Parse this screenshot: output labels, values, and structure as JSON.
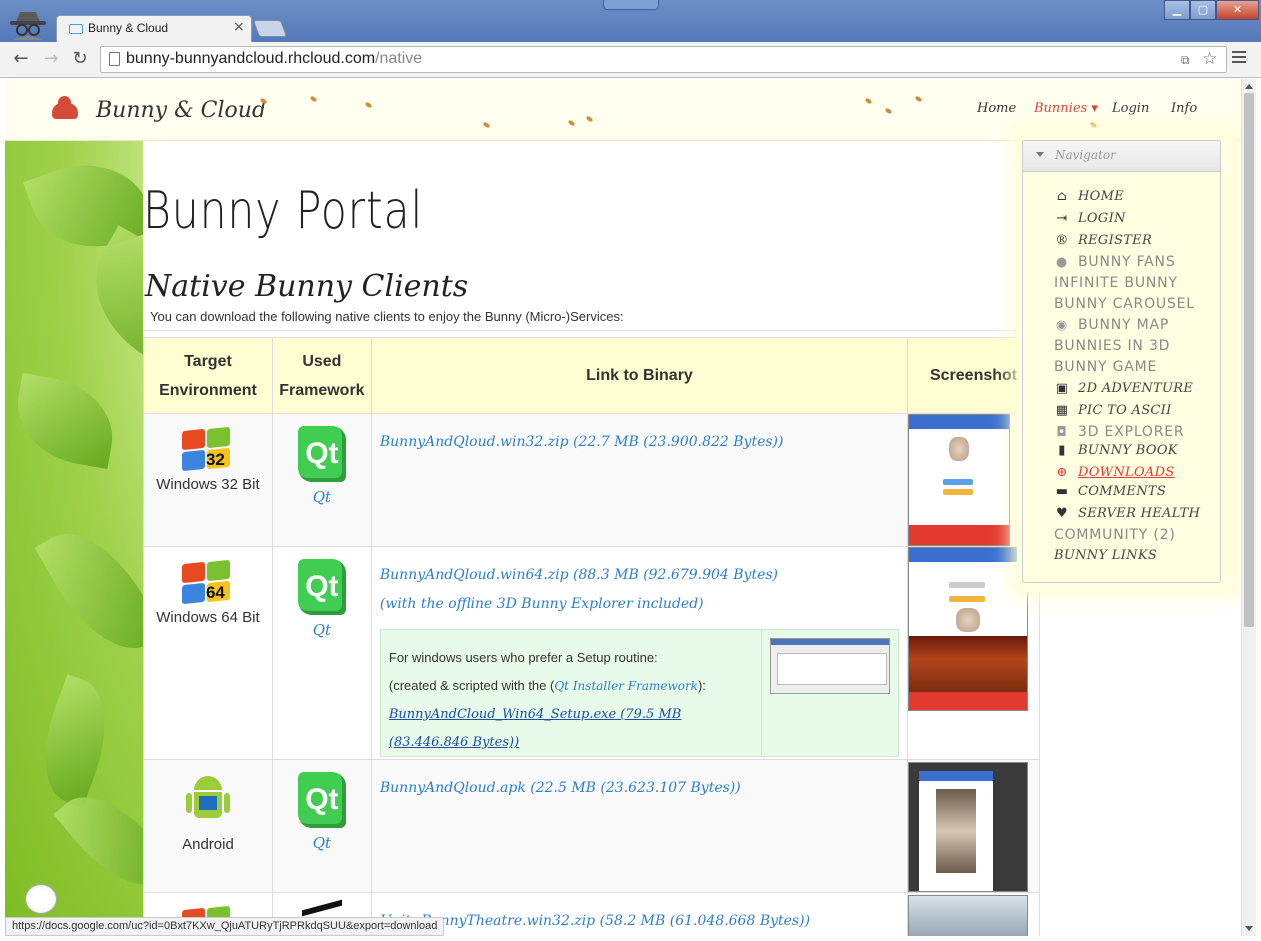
{
  "browser": {
    "tab_title": "Bunny & Cloud",
    "tab_close": "×",
    "url_host": "bunny-bunnyandcloud.rhcloud.com",
    "url_path": "/native",
    "status_url": "https://docs.google.com/uc?id=0Bxt7KXw_QjuATURyTjRPRkdqSUU&export=download"
  },
  "header": {
    "brand": "Bunny & Cloud",
    "nav": [
      {
        "label": "Home"
      },
      {
        "label": "Bunnies ▾"
      },
      {
        "label": "Login"
      },
      {
        "label": "Info"
      }
    ]
  },
  "main": {
    "title": "Bunny  Portal",
    "section_title": "Native Bunny Clients",
    "intro": "You can download the following native clients to enjoy the Bunny (Micro-)Services:",
    "table": {
      "headers": [
        "Target Environment",
        "Used Framework",
        "Link to Binary",
        "Screenshot"
      ],
      "rows": [
        {
          "os": "Windows 32 Bit",
          "os_badge": "32",
          "framework": "Qt",
          "link": "BunnyAndQloud.win32.zip (22.7 MB (23.900.822 Bytes))",
          "link2": ""
        },
        {
          "os": "Windows 64 Bit",
          "os_badge": "64",
          "framework": "Qt",
          "link": "BunnyAndQloud.win64.zip (88.3 MB (92.679.904 Bytes)",
          "link2": "(with the offline 3D Bunny Explorer included)"
        },
        {
          "os": "Android",
          "os_badge": "",
          "framework": "Qt",
          "link": "BunnyAndQloud.apk (22.5 MB (23.623.107 Bytes))",
          "link2": ""
        },
        {
          "os": "",
          "os_badge": "",
          "framework": "",
          "link": "Unity.BunnyTheatre.win32.zip (58.2 MB (61.048.668 Bytes))",
          "link2": ""
        }
      ],
      "setup": {
        "line1": "For windows users who prefer a Setup routine:",
        "line2_pre": "(created & scripted with the (",
        "line2_link": "Qt Installer Framework",
        "line2_post": "):",
        "setup_link": "BunnyAndCloud_Win64_Setup.exe (79.5 MB (83.446.846 Bytes))"
      },
      "qt_logo_text": "Qt"
    }
  },
  "navigator": {
    "title": "Navigator",
    "items": [
      {
        "label": "HOME",
        "icon": "home-icon"
      },
      {
        "label": "LOGIN",
        "icon": "sign-in-icon"
      },
      {
        "label": "REGISTER",
        "icon": "registered-icon"
      },
      {
        "label": "BUNNY FANS",
        "icon": "user-icon"
      },
      {
        "label": "INFINITE BUNNY",
        "icon": ""
      },
      {
        "label": "BUNNY CAROUSEL",
        "icon": ""
      },
      {
        "label": "BUNNY MAP",
        "icon": "map-marker-icon"
      },
      {
        "label": "BUNNIES IN 3D",
        "icon": ""
      },
      {
        "label": "BUNNY GAME",
        "icon": ""
      },
      {
        "label": "2D ADVENTURE",
        "icon": "picture-icon"
      },
      {
        "label": "PIC TO ASCII",
        "icon": "qrcode-icon"
      },
      {
        "label": "3D EXPLORER",
        "icon": "camera-icon"
      },
      {
        "label": "BUNNY BOOK",
        "icon": "book-icon"
      },
      {
        "label": "DOWNLOADS",
        "icon": "download-icon"
      },
      {
        "label": "COMMENTS",
        "icon": "comment-icon"
      },
      {
        "label": "SERVER HEALTH",
        "icon": "heart-icon"
      },
      {
        "label": "COMMUNITY (2)",
        "icon": ""
      },
      {
        "label": "BUNNY LINKS",
        "icon": ""
      }
    ]
  },
  "colors": {
    "link": "#2b7fd1",
    "active": "#e43a3a",
    "header_bg": "#fffed2"
  }
}
